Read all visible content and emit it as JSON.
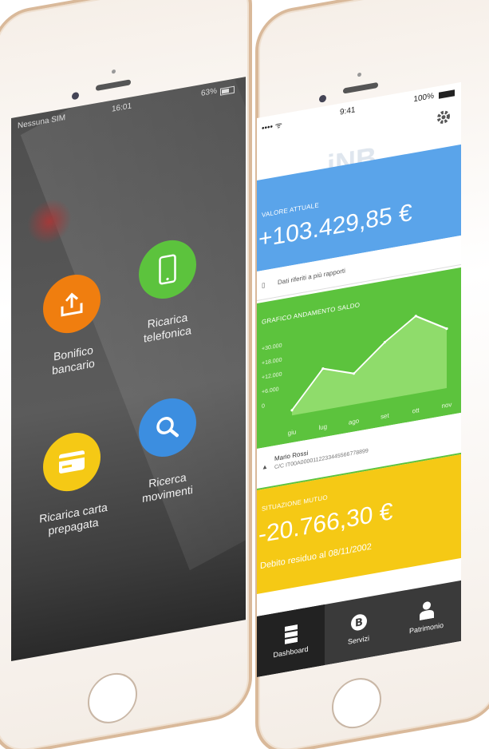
{
  "left_screen": {
    "status": {
      "carrier": "Nessuna SIM",
      "time": "16:01",
      "battery": "63%"
    },
    "menu": [
      {
        "label_line1": "Bonifico",
        "label_line2": "bancario",
        "color": "#f07e0f",
        "icon": "upload-tray-icon"
      },
      {
        "label_line1": "Ricarica",
        "label_line2": "telefonica",
        "color": "#5cc33d",
        "icon": "smartphone-icon"
      },
      {
        "label_line1": "Ricarica carta",
        "label_line2": "prepagata",
        "color": "#f5c915",
        "icon": "credit-card-icon"
      },
      {
        "label_line1": "Ricerca",
        "label_line2": "movimenti",
        "color": "#3c8ee0",
        "icon": "search-icon"
      }
    ]
  },
  "right_screen": {
    "status": {
      "time": "9:41",
      "battery": "100%"
    },
    "logo": "iNB",
    "valore": {
      "title": "VALORE ATTUALE",
      "amount": "+103.429,85 €",
      "note": "Dati riferiti a più rapporti"
    },
    "grafico": {
      "title": "GRAFICO ANDAMENTO SALDO"
    },
    "account": {
      "name": "Mario Rossi",
      "iban": "C/C IT00A0000112233445566778899"
    },
    "mutuo": {
      "title": "SITUAZIONE MUTUO",
      "amount": "-20.766,30 €",
      "subtitle": "Debito residuo al 08/11/2002"
    },
    "tabs": [
      {
        "label": "Dashboard",
        "icon": "dashboard-icon"
      },
      {
        "label": "Servizi",
        "icon": "servizi-b-icon"
      },
      {
        "label": "Patrimonio",
        "icon": "person-icon"
      }
    ]
  },
  "chart_data": {
    "type": "area",
    "categories": [
      "giu",
      "lug",
      "ago",
      "set",
      "ott",
      "nov"
    ],
    "values": [
      2000,
      16000,
      12000,
      22000,
      30000,
      23000
    ],
    "ytick_labels": [
      "+30.000",
      "+18.000",
      "+12.000",
      "+6.000",
      "0"
    ],
    "title": "GRAFICO ANDAMENTO SALDO",
    "xlabel": "",
    "ylabel": "",
    "ylim": [
      0,
      34000
    ],
    "grid": false,
    "colors": {
      "fill": "#8fdc6b",
      "line": "#ffffff"
    }
  }
}
